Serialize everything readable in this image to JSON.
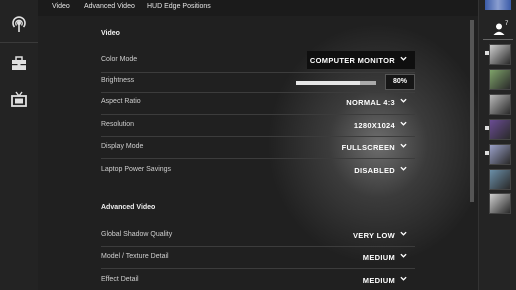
{
  "tabs": [
    "Video",
    "Advanced Video",
    "HUD Edge Positions"
  ],
  "left_rail": {
    "icons": [
      "broadcast-icon",
      "toolbox-icon",
      "tv-icon"
    ]
  },
  "video": {
    "section_title": "Video",
    "settings": [
      {
        "label": "Color Mode",
        "value": "COMPUTER MONITOR"
      },
      {
        "label": "Brightness",
        "value": "80%",
        "level_percent": 80
      },
      {
        "label": "Aspect Ratio",
        "value": "NORMAL 4:3"
      },
      {
        "label": "Resolution",
        "value": "1280X1024"
      },
      {
        "label": "Display Mode",
        "value": "FULLSCREEN"
      },
      {
        "label": "Laptop Power Savings",
        "value": "DISABLED"
      }
    ]
  },
  "advanced": {
    "section_title": "Advanced Video",
    "settings": [
      {
        "label": "Global Shadow Quality",
        "value": "VERY LOW"
      },
      {
        "label": "Model / Texture Detail",
        "value": "MEDIUM"
      },
      {
        "label": "Effect Detail",
        "value": "MEDIUM"
      }
    ]
  },
  "friends": {
    "count": "7",
    "avatar_colors": [
      "#cfcfcf",
      "#7fa36a",
      "#b9b9b9",
      "#6a4c93",
      "#9aa0c8",
      "#6b8fa8"
    ]
  }
}
